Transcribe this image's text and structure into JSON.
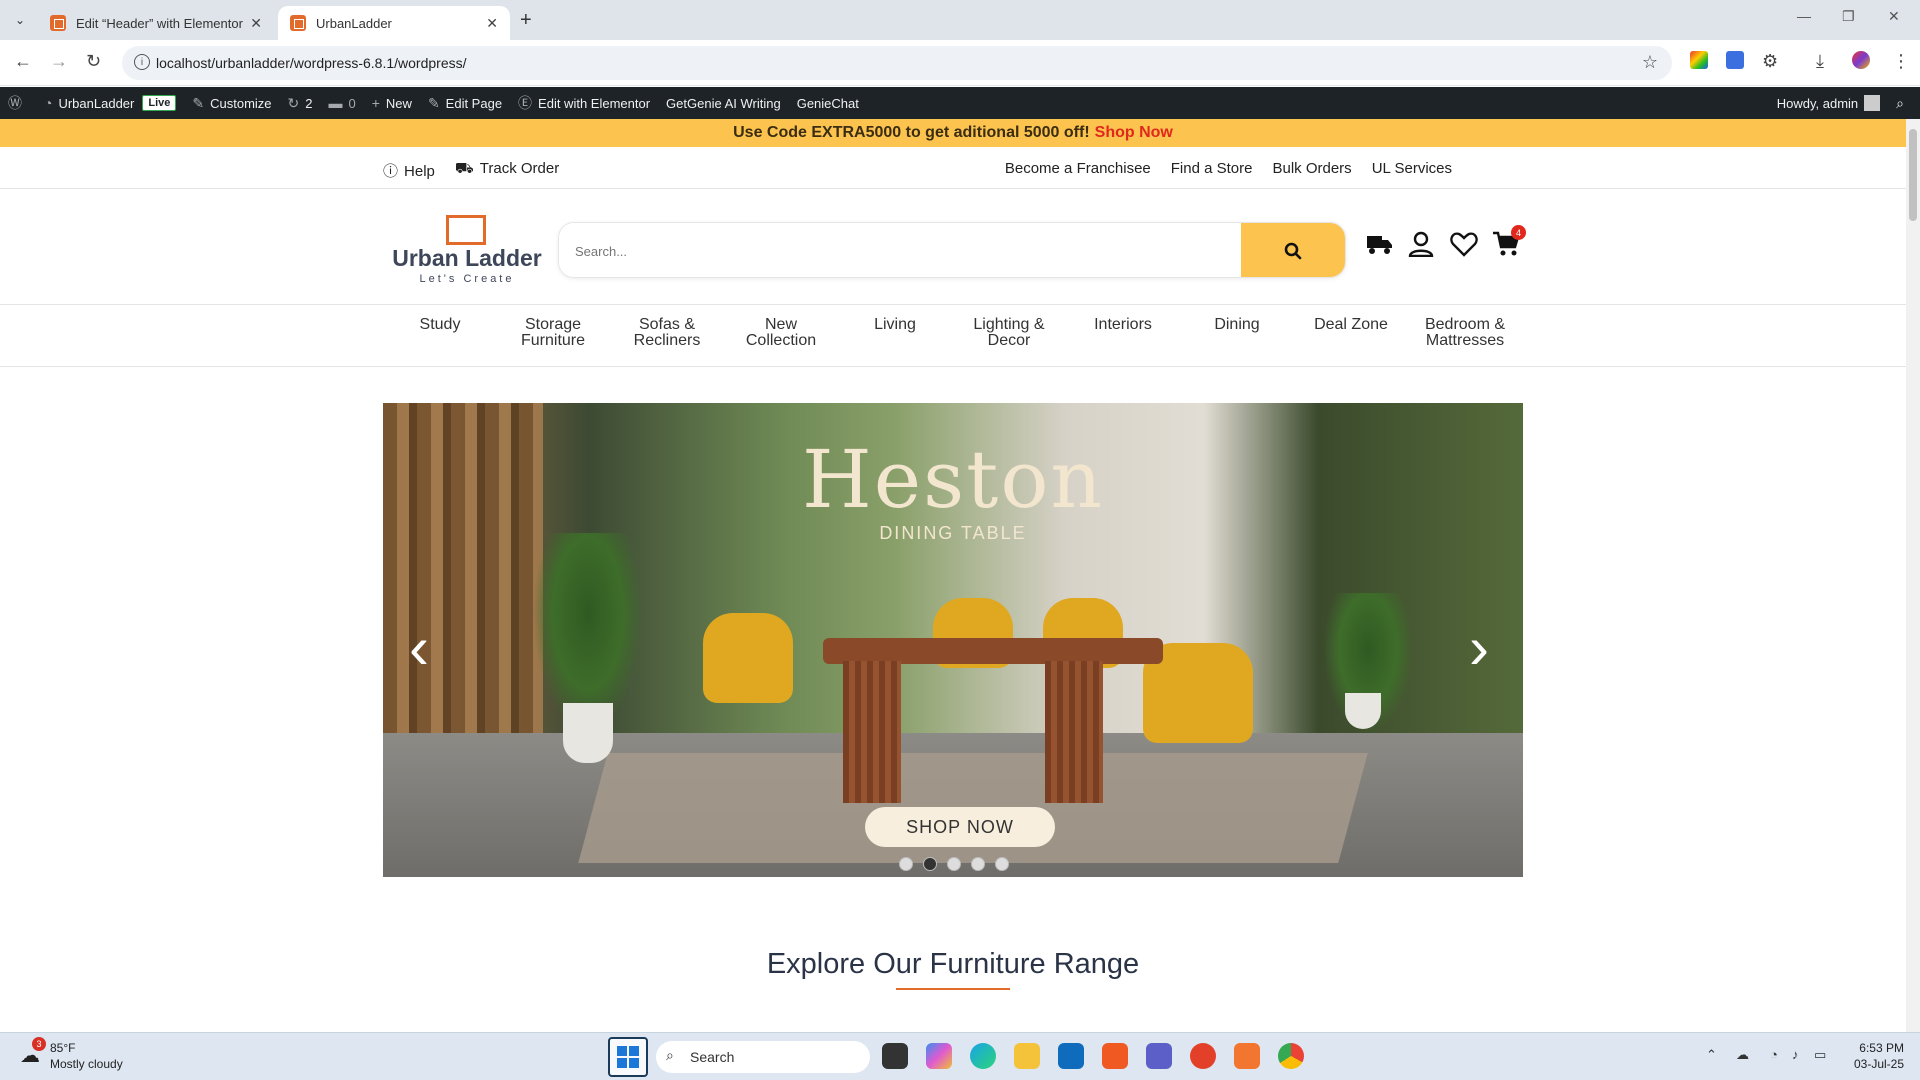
{
  "browser": {
    "tabs": [
      {
        "label": "Edit “Header” with Elementor",
        "active": false
      },
      {
        "label": "UrbanLadder",
        "active": true
      }
    ],
    "url": "localhost/urbanladder/wordpress-6.8.1/wordpress/"
  },
  "adminbar": {
    "site": "UrbanLadder",
    "live": "Live",
    "customize": "Customize",
    "updates": "2",
    "comments": "0",
    "new": "New",
    "edit_page": "Edit Page",
    "elementor": "Edit with Elementor",
    "getgenie": "GetGenie AI Writing",
    "geniechat": "GenieChat",
    "howdy": "Howdy, admin"
  },
  "promo": {
    "text": "Use Code EXTRA5000 to get aditional 5000 off!",
    "link": "Shop Now"
  },
  "utility": {
    "help": "Help",
    "track": "Track Order",
    "franchise": "Become a Franchisee",
    "store": "Find a Store",
    "bulk": "Bulk Orders",
    "services": "UL Services"
  },
  "header": {
    "brand": "Urban Ladder",
    "tagline": "Let's Create",
    "search_placeholder": "Search...",
    "cart_count": "4"
  },
  "categories": [
    {
      "line1": "Study",
      "line2": ""
    },
    {
      "line1": "Storage",
      "line2": "Furniture"
    },
    {
      "line1": "Sofas &",
      "line2": "Recliners"
    },
    {
      "line1": "New",
      "line2": "Collection"
    },
    {
      "line1": "Living",
      "line2": ""
    },
    {
      "line1": "Lighting &",
      "line2": "Decor"
    },
    {
      "line1": "Interiors",
      "line2": ""
    },
    {
      "line1": "Dining",
      "line2": ""
    },
    {
      "line1": "Deal Zone",
      "line2": ""
    },
    {
      "line1": "Bedroom &",
      "line2": "Mattresses"
    }
  ],
  "hero": {
    "title": "Heston",
    "subtitle": "DINING TABLE",
    "cta": "SHOP NOW",
    "slide_count": 5,
    "active_slide": 2
  },
  "section": {
    "title": "Explore Our Furniture Range"
  },
  "taskbar": {
    "temp": "85°F",
    "weather": "Mostly cloudy",
    "weather_badge": "3",
    "search": "Search",
    "time": "6:53 PM",
    "date": "03-Jul-25"
  },
  "colors": {
    "accent": "#fcc34e",
    "brand_orange": "#e26b2b",
    "promo_link": "#e0281d"
  }
}
